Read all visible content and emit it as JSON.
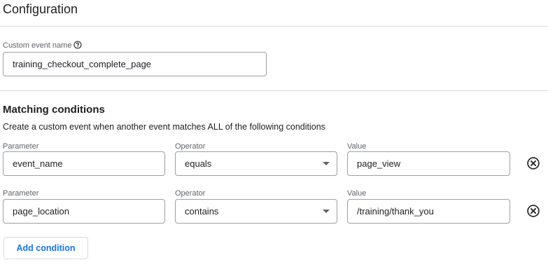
{
  "header": {
    "title": "Configuration"
  },
  "custom_event": {
    "label": "Custom event name",
    "value": "training_checkout_complete_page"
  },
  "matching": {
    "title": "Matching conditions",
    "description": "Create a custom event when another event matches ALL of the following conditions",
    "conditions": [
      {
        "parameter_label": "Parameter",
        "parameter_value": "event_name",
        "operator_label": "Operator",
        "operator_value": "equals",
        "value_label": "Value",
        "value_value": "page_view"
      },
      {
        "parameter_label": "Parameter",
        "parameter_value": "page_location",
        "operator_label": "Operator",
        "operator_value": "contains",
        "value_label": "Value",
        "value_value": "/training/thank_you"
      }
    ],
    "add_label": "Add condition"
  },
  "icons": {
    "help": "help-circle-icon",
    "remove": "cancel-circle-icon",
    "dropdown": "dropdown-caret-icon"
  },
  "colors": {
    "accent": "#1a73e8",
    "border": "#9aa0a6",
    "divider": "#dadce0",
    "text": "#202124",
    "label": "#5f6368"
  }
}
